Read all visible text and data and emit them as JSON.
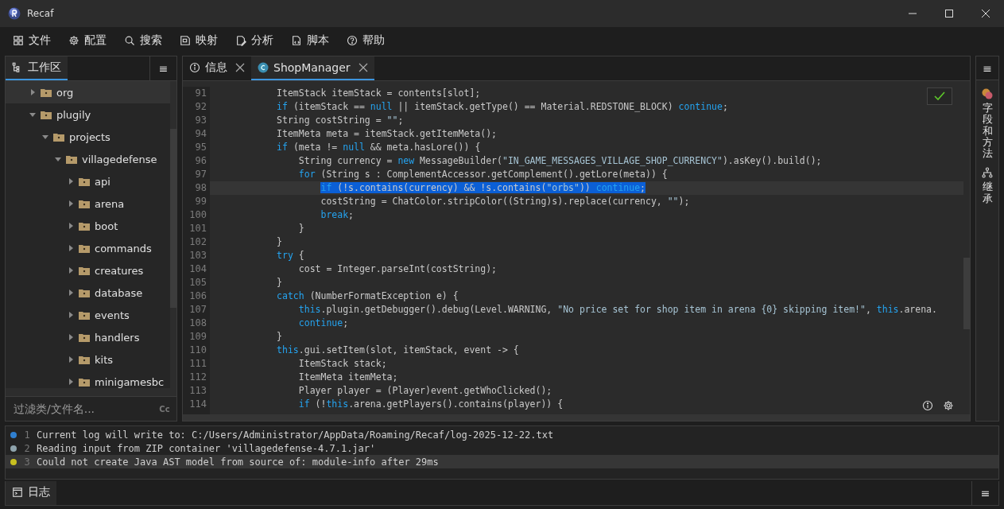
{
  "window": {
    "title": "Recaf"
  },
  "menu": [
    {
      "label": "文件"
    },
    {
      "label": "配置"
    },
    {
      "label": "搜索"
    },
    {
      "label": "映射"
    },
    {
      "label": "分析"
    },
    {
      "label": "脚本"
    },
    {
      "label": "帮助"
    }
  ],
  "workspace_panel": {
    "tab": {
      "label": "工作区",
      "selected": true
    },
    "menu_glyph": "≡",
    "tree": [
      {
        "label": "org",
        "expanded": false,
        "selected": true
      },
      {
        "label": "plugily",
        "expanded": true,
        "selected": false,
        "children": [
          {
            "label": "projects",
            "expanded": true,
            "selected": false,
            "children": [
              {
                "label": "villagedefense",
                "expanded": true,
                "selected": false,
                "children": [
                  {
                    "label": "api",
                    "expanded": false,
                    "selected": false
                  },
                  {
                    "label": "arena",
                    "expanded": false,
                    "selected": false
                  },
                  {
                    "label": "boot",
                    "expanded": false,
                    "selected": false
                  },
                  {
                    "label": "commands",
                    "expanded": false,
                    "selected": false
                  },
                  {
                    "label": "creatures",
                    "expanded": false,
                    "selected": false
                  },
                  {
                    "label": "database",
                    "expanded": false,
                    "selected": false
                  },
                  {
                    "label": "events",
                    "expanded": false,
                    "selected": false
                  },
                  {
                    "label": "handlers",
                    "expanded": false,
                    "selected": false
                  },
                  {
                    "label": "kits",
                    "expanded": false,
                    "selected": false
                  },
                  {
                    "label": "minigamesbc",
                    "expanded": false,
                    "selected": false
                  }
                ]
              }
            ]
          }
        ]
      }
    ],
    "filter": {
      "placeholder": "过滤类/文件名...",
      "case_toggle": "Cc"
    }
  },
  "editor": {
    "tabs": [
      {
        "label": "信息",
        "selected": false
      },
      {
        "label": "ShopManager",
        "selected": true
      }
    ],
    "menu_glyph": "≡",
    "lines": [
      {
        "number": "91",
        "selected": false,
        "tokens": [
          {
            "kind": "plain",
            "text": "            ItemStack itemStack = contents[slot];"
          }
        ]
      },
      {
        "number": "92",
        "selected": false,
        "tokens": [
          {
            "kind": "kw",
            "text": "            if"
          },
          {
            "kind": "plain",
            "text": " (itemStack == "
          },
          {
            "kind": "kw",
            "text": "null"
          },
          {
            "kind": "plain",
            "text": " || itemStack.getType() == Material.REDSTONE_BLOCK) "
          },
          {
            "kind": "kw",
            "text": "continue"
          },
          {
            "kind": "plain",
            "text": ";"
          }
        ]
      },
      {
        "number": "93",
        "selected": false,
        "tokens": [
          {
            "kind": "plain",
            "text": "            String costString = "
          },
          {
            "kind": "str",
            "text": "\"\""
          },
          {
            "kind": "plain",
            "text": ";"
          }
        ]
      },
      {
        "number": "94",
        "selected": false,
        "tokens": [
          {
            "kind": "plain",
            "text": "            ItemMeta meta = itemStack.getItemMeta();"
          }
        ]
      },
      {
        "number": "95",
        "selected": false,
        "tokens": [
          {
            "kind": "kw",
            "text": "            if"
          },
          {
            "kind": "plain",
            "text": " (meta != "
          },
          {
            "kind": "kw",
            "text": "null"
          },
          {
            "kind": "plain",
            "text": " && meta.hasLore()) {"
          }
        ]
      },
      {
        "number": "96",
        "selected": false,
        "tokens": [
          {
            "kind": "plain",
            "text": "                String currency = "
          },
          {
            "kind": "kw",
            "text": "new"
          },
          {
            "kind": "plain",
            "text": " MessageBuilder("
          },
          {
            "kind": "str",
            "text": "\"IN_GAME_MESSAGES_VILLAGE_SHOP_CURRENCY\""
          },
          {
            "kind": "plain",
            "text": ").asKey().build();"
          }
        ]
      },
      {
        "number": "97",
        "selected": false,
        "tokens": [
          {
            "kind": "kw",
            "text": "                for"
          },
          {
            "kind": "plain",
            "text": " (String s : ComplementAccessor.getComplement().getLore(meta)) {"
          }
        ]
      },
      {
        "number": "98",
        "selected": true,
        "tokens": [
          {
            "kind": "kw",
            "text": "                    if"
          },
          {
            "kind": "plain",
            "text": " (!s.contains(currency) && !s.contains("
          },
          {
            "kind": "str",
            "text": "\"orbs\""
          },
          {
            "kind": "plain",
            "text": ")) "
          },
          {
            "kind": "kw",
            "text": "continue"
          },
          {
            "kind": "plain",
            "text": ";"
          }
        ]
      },
      {
        "number": "99",
        "selected": false,
        "tokens": [
          {
            "kind": "plain",
            "text": "                    costString = ChatColor.stripColor((String)s).replace(currency, "
          },
          {
            "kind": "str",
            "text": "\"\""
          },
          {
            "kind": "plain",
            "text": ");"
          }
        ]
      },
      {
        "number": "100",
        "selected": false,
        "tokens": [
          {
            "kind": "kw",
            "text": "                    break"
          },
          {
            "kind": "plain",
            "text": ";"
          }
        ]
      },
      {
        "number": "101",
        "selected": false,
        "tokens": [
          {
            "kind": "plain",
            "text": "                }"
          }
        ]
      },
      {
        "number": "102",
        "selected": false,
        "tokens": [
          {
            "kind": "plain",
            "text": "            }"
          }
        ]
      },
      {
        "number": "103",
        "selected": false,
        "tokens": [
          {
            "kind": "kw",
            "text": "            try"
          },
          {
            "kind": "plain",
            "text": " {"
          }
        ]
      },
      {
        "number": "104",
        "selected": false,
        "tokens": [
          {
            "kind": "plain",
            "text": "                cost = Integer.parseInt(costString);"
          }
        ]
      },
      {
        "number": "105",
        "selected": false,
        "tokens": [
          {
            "kind": "plain",
            "text": "            }"
          }
        ]
      },
      {
        "number": "106",
        "selected": false,
        "tokens": [
          {
            "kind": "kw",
            "text": "            catch"
          },
          {
            "kind": "plain",
            "text": " (NumberFormatException e) {"
          }
        ]
      },
      {
        "number": "107",
        "selected": false,
        "tokens": [
          {
            "kind": "kw",
            "text": "                this"
          },
          {
            "kind": "plain",
            "text": ".plugin.getDebugger().debug(Level.WARNING, "
          },
          {
            "kind": "str",
            "text": "\"No price set for shop item in arena {0} skipping item!\""
          },
          {
            "kind": "plain",
            "text": ", "
          },
          {
            "kind": "kw",
            "text": "this"
          },
          {
            "kind": "plain",
            "text": ".arena."
          }
        ]
      },
      {
        "number": "108",
        "selected": false,
        "tokens": [
          {
            "kind": "kw",
            "text": "                continue"
          },
          {
            "kind": "plain",
            "text": ";"
          }
        ]
      },
      {
        "number": "109",
        "selected": false,
        "tokens": [
          {
            "kind": "plain",
            "text": "            }"
          }
        ]
      },
      {
        "number": "110",
        "selected": false,
        "tokens": [
          {
            "kind": "kw",
            "text": "            this"
          },
          {
            "kind": "plain",
            "text": ".gui.setItem(slot, itemStack, event -> {"
          }
        ]
      },
      {
        "number": "111",
        "selected": false,
        "tokens": [
          {
            "kind": "plain",
            "text": "                ItemStack stack;"
          }
        ]
      },
      {
        "number": "112",
        "selected": false,
        "tokens": [
          {
            "kind": "plain",
            "text": "                ItemMeta itemMeta;"
          }
        ]
      },
      {
        "number": "113",
        "selected": false,
        "tokens": [
          {
            "kind": "plain",
            "text": "                Player player = (Player)event.getWhoClicked();"
          }
        ]
      },
      {
        "number": "114",
        "selected": false,
        "tokens": [
          {
            "kind": "kw",
            "text": "                if"
          },
          {
            "kind": "plain",
            "text": " (!"
          },
          {
            "kind": "kw",
            "text": "this"
          },
          {
            "kind": "plain",
            "text": ".arena.getPlayers().contains(player)) {"
          }
        ]
      }
    ]
  },
  "side_tabs": [
    {
      "label": "字段和方法"
    },
    {
      "label": "继承"
    }
  ],
  "log": [
    {
      "number": "1",
      "color": "#2f7fd0",
      "selected": false,
      "text": "Current log will write to: C:/Users/Administrator/AppData/Roaming/Recaf/log-2025-12-22.txt"
    },
    {
      "number": "2",
      "color": "#8fa4ad",
      "selected": false,
      "text": "Reading input from ZIP container 'villagedefense-4.7.1.jar'"
    },
    {
      "number": "3",
      "color": "#c8c020",
      "selected": true,
      "text": "Could not create Java AST model from source of: module-info after 29ms"
    }
  ],
  "bottom_bar": {
    "tab": {
      "label": "日志",
      "selected": true
    },
    "menu_glyph": "≡"
  }
}
